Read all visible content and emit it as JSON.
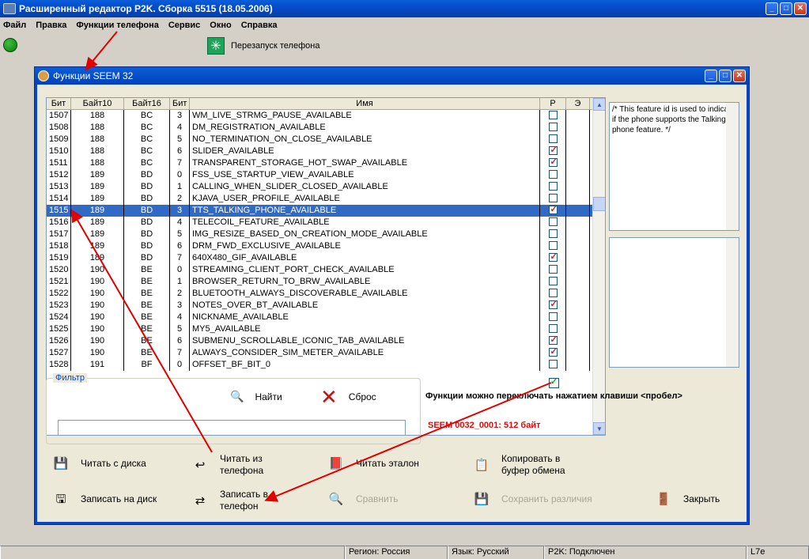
{
  "app": {
    "title": "Расширенный редактор P2K. Сборка 5515 (18.05.2006)",
    "window_buttons": [
      "_",
      "□",
      "✕"
    ]
  },
  "menu": [
    {
      "label": "Файл",
      "key": "Ф"
    },
    {
      "label": "Правка",
      "key": "П"
    },
    {
      "label": "Функции телефона",
      "key": "Ф"
    },
    {
      "label": "Сервис",
      "key": "С"
    },
    {
      "label": "Окно",
      "key": "О"
    },
    {
      "label": "Справка",
      "key": "С"
    }
  ],
  "toolbar": {
    "restart_label": "Перезапуск телефона"
  },
  "dialog": {
    "title": "Функции SEEM 32",
    "columns": [
      "Бит",
      "Байт10",
      "Байт16",
      "Бит",
      "Имя",
      "Р",
      "Э"
    ],
    "rows": [
      {
        "bit": "1507",
        "b10": "188",
        "b16": "BC",
        "b": "3",
        "name": "WM_LIVE_STRMG_PAUSE_AVAILABLE",
        "p": false
      },
      {
        "bit": "1508",
        "b10": "188",
        "b16": "BC",
        "b": "4",
        "name": "DM_REGISTRATION_AVAILABLE",
        "p": false
      },
      {
        "bit": "1509",
        "b10": "188",
        "b16": "BC",
        "b": "5",
        "name": "NO_TERMINATION_ON_CLOSE_AVAILABLE",
        "p": false
      },
      {
        "bit": "1510",
        "b10": "188",
        "b16": "BC",
        "b": "6",
        "name": "SLIDER_AVAILABLE",
        "p": true
      },
      {
        "bit": "1511",
        "b10": "188",
        "b16": "BC",
        "b": "7",
        "name": "TRANSPARENT_STORAGE_HOT_SWAP_AVAILABLE",
        "p": true
      },
      {
        "bit": "1512",
        "b10": "189",
        "b16": "BD",
        "b": "0",
        "name": "FSS_USE_STARTUP_VIEW_AVAILABLE",
        "p": false
      },
      {
        "bit": "1513",
        "b10": "189",
        "b16": "BD",
        "b": "1",
        "name": "CALLING_WHEN_SLIDER_CLOSED_AVAILABLE",
        "p": false
      },
      {
        "bit": "1514",
        "b10": "189",
        "b16": "BD",
        "b": "2",
        "name": "KJAVA_USER_PROFILE_AVAILABLE",
        "p": false
      },
      {
        "bit": "1515",
        "b10": "189",
        "b16": "BD",
        "b": "3",
        "name": "TTS_TALKING_PHONE_AVAILABLE",
        "p": true,
        "selected": true
      },
      {
        "bit": "1516",
        "b10": "189",
        "b16": "BD",
        "b": "4",
        "name": "TELECOIL_FEATURE_AVAILABLE",
        "p": false
      },
      {
        "bit": "1517",
        "b10": "189",
        "b16": "BD",
        "b": "5",
        "name": "IMG_RESIZE_BASED_ON_CREATION_MODE_AVAILABLE",
        "p": false
      },
      {
        "bit": "1518",
        "b10": "189",
        "b16": "BD",
        "b": "6",
        "name": "DRM_FWD_EXCLUSIVE_AVAILABLE",
        "p": false
      },
      {
        "bit": "1519",
        "b10": "189",
        "b16": "BD",
        "b": "7",
        "name": "640X480_GIF_AVAILABLE",
        "p": true
      },
      {
        "bit": "1520",
        "b10": "190",
        "b16": "BE",
        "b": "0",
        "name": "STREAMING_CLIENT_PORT_CHECK_AVAILABLE",
        "p": false
      },
      {
        "bit": "1521",
        "b10": "190",
        "b16": "BE",
        "b": "1",
        "name": "BROWSER_RETURN_TO_BRW_AVAILABLE",
        "p": false
      },
      {
        "bit": "1522",
        "b10": "190",
        "b16": "BE",
        "b": "2",
        "name": "BLUETOOTH_ALWAYS_DISCOVERABLE_AVAILABLE",
        "p": false
      },
      {
        "bit": "1523",
        "b10": "190",
        "b16": "BE",
        "b": "3",
        "name": "NOTES_OVER_BT_AVAILABLE",
        "p": true
      },
      {
        "bit": "1524",
        "b10": "190",
        "b16": "BE",
        "b": "4",
        "name": "NICKNAME_AVAILABLE",
        "p": false
      },
      {
        "bit": "1525",
        "b10": "190",
        "b16": "BE",
        "b": "5",
        "name": "MY5_AVAILABLE",
        "p": false
      },
      {
        "bit": "1526",
        "b10": "190",
        "b16": "BE",
        "b": "6",
        "name": "SUBMENU_SCROLLABLE_ICONIC_TAB_AVAILABLE",
        "p": true
      },
      {
        "bit": "1527",
        "b10": "190",
        "b16": "BE",
        "b": "7",
        "name": "ALWAYS_CONSIDER_SIM_METER_AVAILABLE",
        "p": true
      },
      {
        "bit": "1528",
        "b10": "191",
        "b16": "BF",
        "b": "0",
        "name": "OFFSET_BF_BIT_0",
        "p": false
      }
    ],
    "description": "/* This feature id is used to indicate if the phone supports the Talking phone feature. */",
    "filter": {
      "legend": "Фильтр",
      "find_label": "Найти",
      "reset_label": "Сброс",
      "input_value": ""
    },
    "space_toggle_label": "Функции можно переключать нажатием клавиши <пробел>",
    "seem_info": "SEEM 0032_0001: 512 байт",
    "actions": {
      "read_disk": "Читать с диска",
      "read_phone": "Читать из телефона",
      "read_reference": "Читать эталон",
      "copy_clipboard": "Копировать в буфер обмена",
      "write_disk": "Записать на диск",
      "write_phone": "Записать в телефон",
      "compare": "Сравнить",
      "save_diff": "Сохранить различия",
      "close": "Закрыть"
    }
  },
  "statusbar": {
    "region": "Регион: Россия",
    "language": "Язык: Русский",
    "connection": "P2K: Подключен",
    "model": "L7e"
  },
  "colors": {
    "titlebar": "#0450d0",
    "selection": "#316ac5",
    "accent_red": "#d01010",
    "annotation_arrow": "#e00000"
  }
}
